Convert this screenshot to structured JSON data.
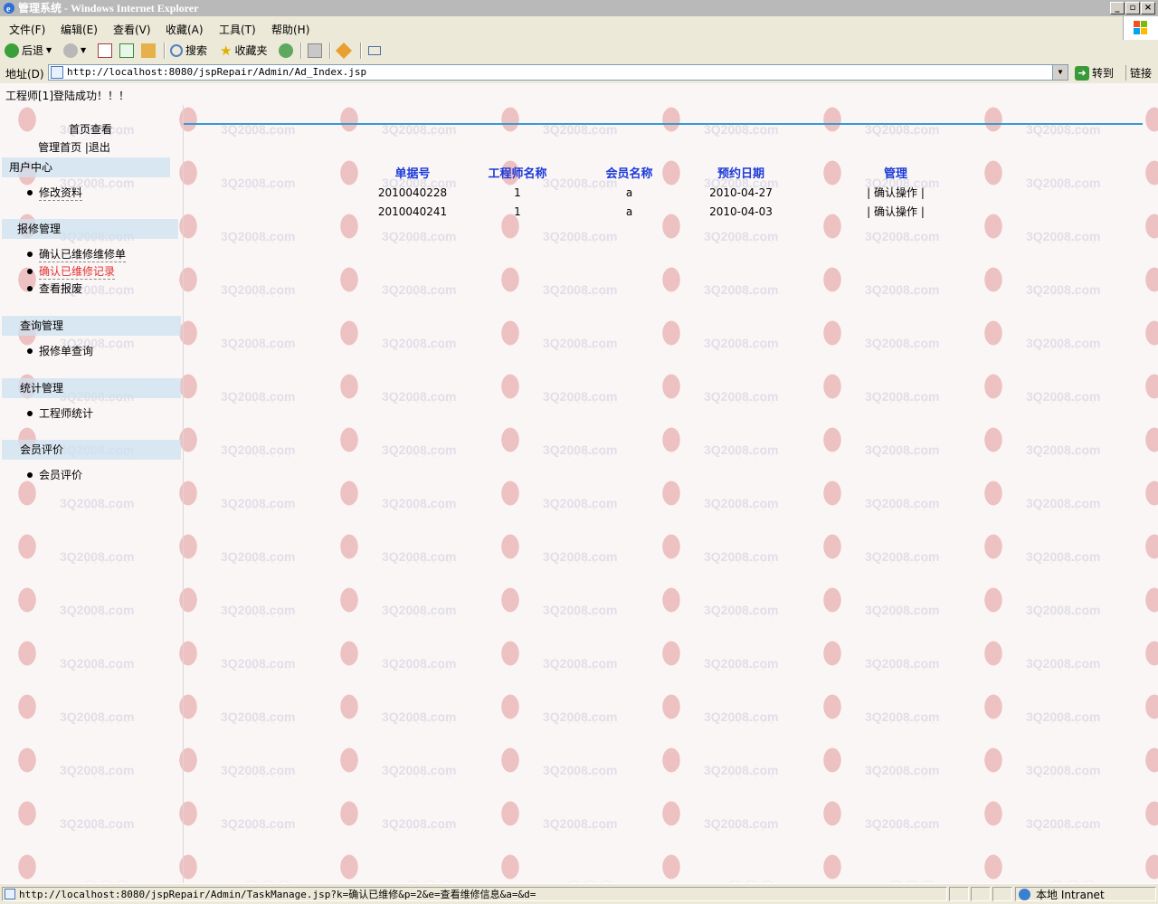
{
  "window": {
    "title": "管理系统 - Windows Internet Explorer",
    "buttons": [
      "_",
      "▫",
      "×"
    ]
  },
  "menu": [
    "文件(F)",
    "编辑(E)",
    "查看(V)",
    "收藏(A)",
    "工具(T)",
    "帮助(H)"
  ],
  "toolbar": {
    "back": "后退",
    "search": "搜索",
    "favorites": "收藏夹"
  },
  "address": {
    "label": "地址(D)",
    "url": "http://localhost:8080/jspRepair/Admin/Ad_Index.jsp",
    "go": "转到",
    "links": "链接"
  },
  "page": {
    "login_message": "工程师[1]登陆成功！！！",
    "sidebar": {
      "top_links": [
        "首页查看",
        "管理首页 |退出"
      ],
      "sections": [
        {
          "title": "用户中心",
          "items": [
            {
              "label": "修改资料",
              "active": false
            }
          ]
        },
        {
          "title": "报修管理",
          "items": [
            {
              "label": "确认已维修维修单",
              "active": false
            },
            {
              "label": "确认已维修记录",
              "active": true
            },
            {
              "label": "查看报废",
              "active": false
            }
          ]
        },
        {
          "title": "查询管理",
          "items": [
            {
              "label": "报修单查询",
              "active": false
            }
          ]
        },
        {
          "title": "统计管理",
          "items": [
            {
              "label": "工程师统计",
              "active": false
            }
          ]
        },
        {
          "title": "会员评价",
          "items": [
            {
              "label": "会员评价",
              "active": false
            }
          ]
        }
      ]
    },
    "table": {
      "headers": [
        "单据号",
        "工程师名称",
        "会员名称",
        "预约日期",
        "管理"
      ],
      "rows": [
        [
          "2010040228",
          "1",
          "a",
          "2010-04-27",
          "| 确认操作 |"
        ],
        [
          "2010040241",
          "1",
          "a",
          "2010-04-03",
          "| 确认操作 |"
        ]
      ]
    },
    "watermark": "3Q2008.com"
  },
  "status": {
    "text": "http://localhost:8080/jspRepair/Admin/TaskManage.jsp?k=确认已维修&p=2&e=查看维修信息&a=&d=",
    "zone": "本地 Intranet"
  },
  "colors": {
    "header_text": "#1a3ad8",
    "active_link": "#e03030",
    "divider": "#3a9ad0",
    "section_bg": "#cde1f0"
  }
}
